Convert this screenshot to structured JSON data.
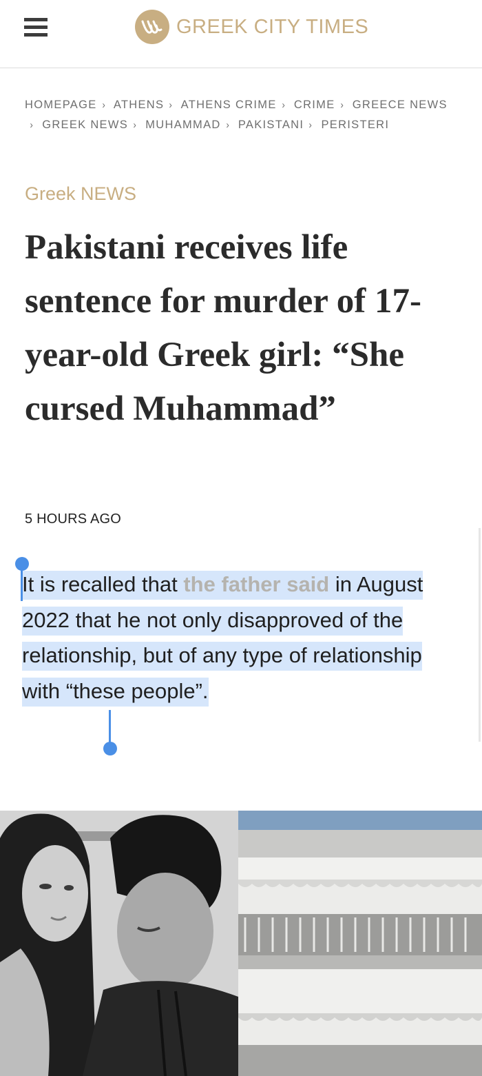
{
  "header": {
    "menu_icon": "hamburger-menu-icon",
    "logo_icon": "greek-city-times-logo-icon",
    "site_name": "GREEK CITY TIMES"
  },
  "breadcrumb": [
    "HOMEPAGE",
    "ATHENS",
    "ATHENS CRIME",
    "CRIME",
    "GREECE NEWS",
    "GREEK NEWS",
    "MUHAMMAD",
    "PAKISTANI",
    "PERISTERI"
  ],
  "breadcrumb_separator": "›",
  "article": {
    "category": "Greek NEWS",
    "headline": "Pakistani receives life sentence for murder of 17-year-old Greek girl: “She cursed Muhammad”",
    "time": "5 HOURS AGO",
    "paragraph": {
      "before": "It is recalled that ",
      "link": "the father said",
      "after": " in August 2022 that he not only disapproved of the relationship, but of any type of relationship with “these people”."
    },
    "images": [
      {
        "name": "couple-photo"
      },
      {
        "name": "building-photo"
      }
    ]
  },
  "colors": {
    "brand_gold": "#c8ae82",
    "selection_highlight": "#d6e6fb",
    "selection_handle": "#4a8fe6",
    "link_gray": "#b5b3ae"
  }
}
